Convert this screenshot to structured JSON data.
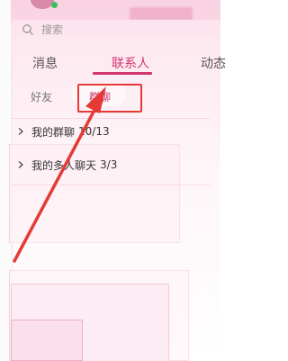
{
  "search": {
    "placeholder": "搜索"
  },
  "tabs": [
    {
      "label": "消息"
    },
    {
      "label": "联系人"
    },
    {
      "label": "动态"
    }
  ],
  "subtabs": [
    {
      "label": "好友"
    },
    {
      "label": "群聊"
    }
  ],
  "groups": [
    {
      "label": "我的群聊",
      "count": "10/13"
    },
    {
      "label": "我的多人聊天",
      "count": "3/3"
    }
  ],
  "colors": {
    "accent": "#d2366e",
    "annotation": "#e53935"
  },
  "icons": {
    "search": "search-icon",
    "expand": "chevron-right-icon"
  }
}
